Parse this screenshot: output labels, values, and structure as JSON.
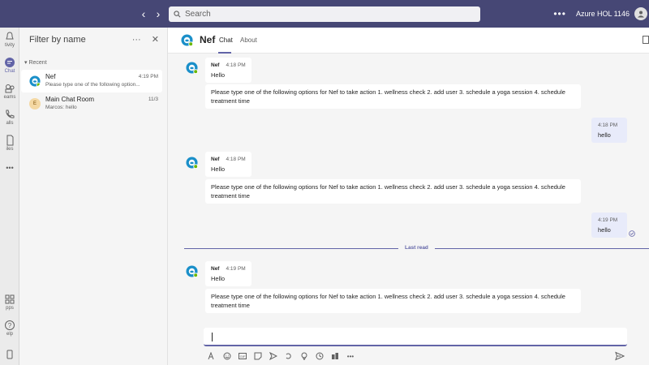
{
  "search": {
    "placeholder": "Search",
    "value": "Search"
  },
  "top": {
    "org": "Azure HOL 1146",
    "more": "•••"
  },
  "rail": [
    {
      "label": "Activity",
      "display": "tivity"
    },
    {
      "label": "Chat",
      "display": "Chat"
    },
    {
      "label": "Teams",
      "display": "eams"
    },
    {
      "label": "Calls",
      "display": "alls"
    },
    {
      "label": "Files",
      "display": "iles"
    },
    {
      "label": "More",
      "display": "•••"
    },
    {
      "label": "Apps",
      "display": "pps"
    },
    {
      "label": "Help",
      "display": "elp"
    }
  ],
  "list": {
    "filter": "Filter by name",
    "more": "···",
    "close": "✕",
    "section": "Recent",
    "chats": [
      {
        "name": "Nef",
        "time": "4:19 PM",
        "preview": "Please type one of the following option..."
      },
      {
        "name": "Main Chat Room",
        "time": "11/3",
        "preview": "Marcos: hello",
        "avatar_letter": "E"
      }
    ]
  },
  "header": {
    "title": "Nef",
    "tabs": [
      "Chat",
      "About"
    ]
  },
  "messages": {
    "prompt": "Please type one of the following options for Nef to take action 1. wellness check 2. add user 3. schedule a yoga session 4. schedule treatment time",
    "groups": [
      {
        "sender": "Nef",
        "time": "4:18 PM",
        "text": "Hello"
      },
      {
        "mine_time": "4:18 PM",
        "mine_text": "hello"
      },
      {
        "sender": "Nef",
        "time": "4:18 PM",
        "text": "Hello"
      },
      {
        "mine_time": "4:19 PM",
        "mine_text": "hello"
      },
      {
        "sender": "Nef",
        "time": "4:19 PM",
        "text": "Hello"
      }
    ],
    "last_read": "Last read"
  },
  "colors": {
    "titlebar": "#464775",
    "accent": "#6264a7",
    "mine_bubble": "#e8ebfa"
  }
}
